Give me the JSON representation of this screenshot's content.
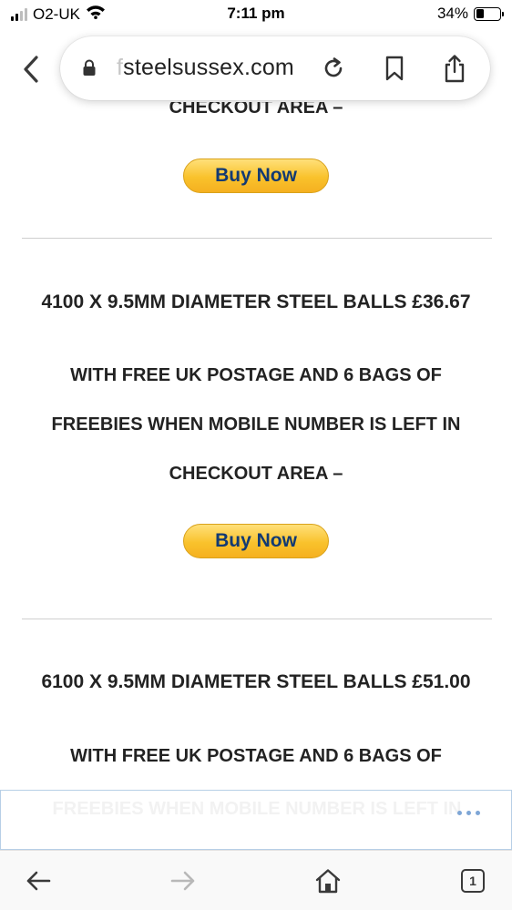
{
  "status_bar": {
    "carrier": "O2-UK",
    "time": "7:11 pm",
    "battery_percent": "34%",
    "battery_level": 0.34
  },
  "address_bar": {
    "url_faded_prefix": "f",
    "url_text": "steelsussex.com",
    "icons": [
      "lock-icon",
      "reload-icon",
      "bookmark-icon",
      "share-icon"
    ]
  },
  "page": {
    "cut_off_text": "CHECKOUT AREA –",
    "buy_label": "Buy Now",
    "products": [
      {
        "title": "4100 X 9.5MM DIAMETER STEEL BALLS £36.67",
        "lines": [
          "WITH FREE UK POSTAGE AND 6 BAGS OF",
          "FREEBIES WHEN MOBILE NUMBER IS LEFT IN",
          "CHECKOUT AREA –"
        ]
      },
      {
        "title": "6100 X 9.5MM DIAMETER STEEL BALLS £51.00",
        "lines": [
          "WITH FREE UK POSTAGE AND 6 BAGS OF",
          "FREEBIES WHEN MOBILE NUMBER IS LEFT IN"
        ]
      }
    ]
  },
  "toolbar": {
    "tab_count": "1",
    "icons": [
      "back-arrow-icon",
      "forward-arrow-icon",
      "home-icon",
      "tabs-icon"
    ]
  },
  "colors": {
    "buy_button": "#f9c22c",
    "buy_text": "#123a73",
    "overlay_border": "#b7cfe6",
    "more_dots": "#7ea6d6"
  }
}
